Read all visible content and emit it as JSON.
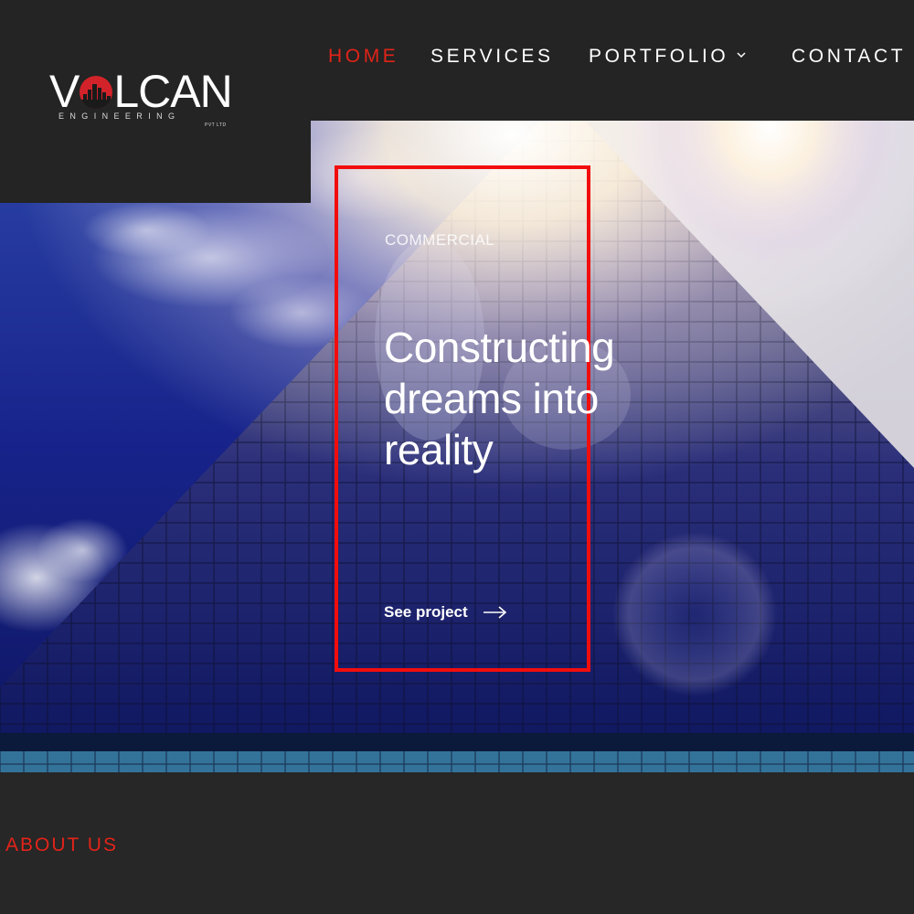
{
  "header": {
    "logo": {
      "word_left": "V",
      "word_right": "LCAN",
      "subtitle": "ENGINEERING",
      "pvt": "PVT LTD",
      "accent": "#d2232a"
    },
    "nav": {
      "home": "HOME",
      "services": "SERVICES",
      "portfolio": "PORTFOLIO",
      "contact": "CONTACT",
      "active_color": "#e2231a"
    }
  },
  "hero": {
    "category": "COMMERCIAL",
    "title": "Constructing dreams into reality",
    "link_label": "See project",
    "frame_color": "#f20d0d"
  },
  "section": {
    "heading": "ABOUT US"
  },
  "icons": {
    "portfolio_dropdown": "chevron-down-icon",
    "see_project": "arrow-right-icon"
  }
}
